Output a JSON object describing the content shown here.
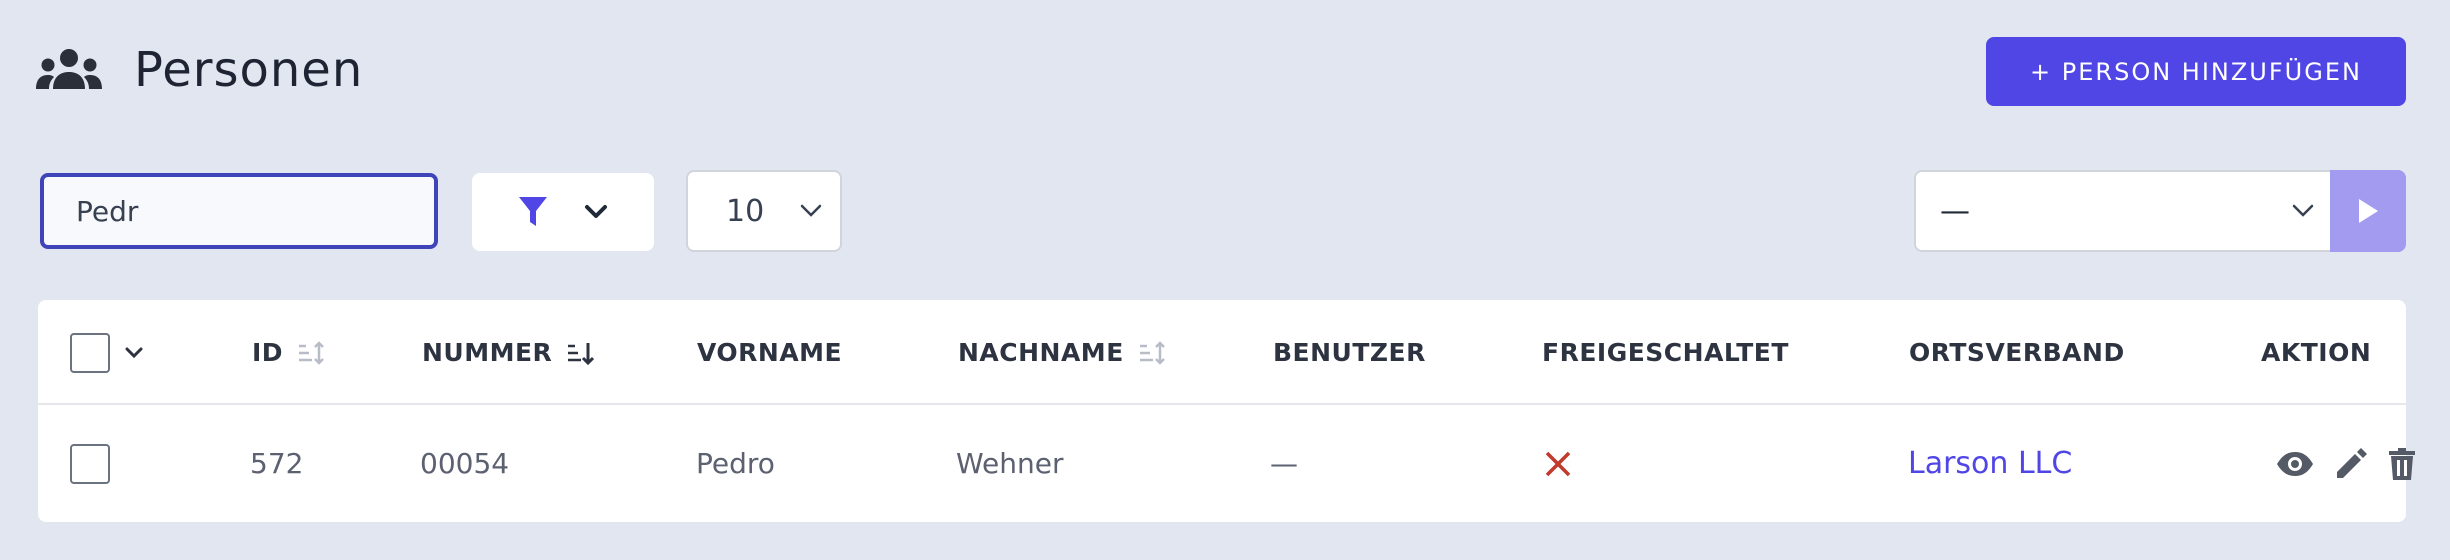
{
  "page": {
    "title": "Personen"
  },
  "toolbar": {
    "add_label": "+ PERSON HINZUFÜGEN"
  },
  "search": {
    "value": "Pedr"
  },
  "per_page": {
    "value": "10"
  },
  "bulk_action": {
    "value": "—"
  },
  "table": {
    "columns": [
      "ID",
      "NUMMER",
      "VORNAME",
      "NACHNAME",
      "BENUTZER",
      "FREIGESCHALTET",
      "ORTSVERBAND",
      "AKTION"
    ],
    "rows": [
      {
        "id": "572",
        "nummer": "00054",
        "vorname": "Pedro",
        "nachname": "Wehner",
        "benutzer": "—",
        "freigeschaltet": false,
        "ortsverband": "Larson LLC"
      }
    ]
  },
  "colors": {
    "accent": "#5046e5",
    "background": "#e2e6f0",
    "danger": "#c0392b",
    "link": "#4f46e5"
  },
  "icons": [
    "people-icon",
    "search-icon",
    "clear-icon",
    "filter-icon",
    "chevron-down-icon",
    "play-icon",
    "sort-icon",
    "sort-desc-icon",
    "eye-icon",
    "pencil-icon",
    "trash-icon",
    "cross-icon"
  ]
}
